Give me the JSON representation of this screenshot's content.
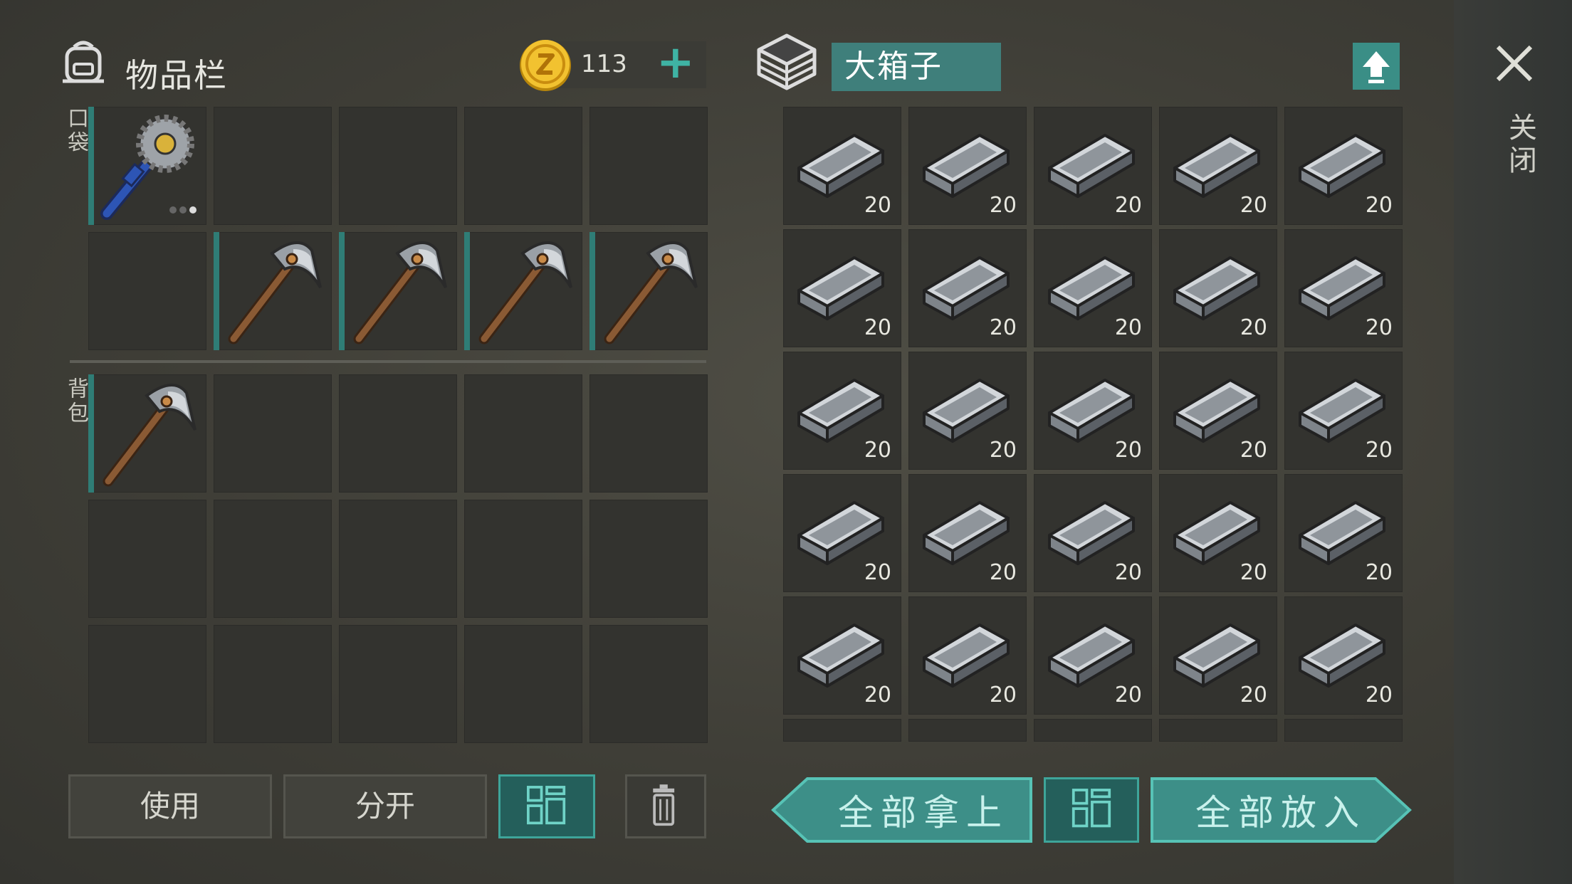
{
  "inventory": {
    "title": "物品栏",
    "coins": "113",
    "plus": "+",
    "pocket_label": "口袋",
    "backpack_label": "背包",
    "pocket_slots": [
      {
        "item": "saw-mace"
      },
      {
        "item": ""
      },
      {
        "item": ""
      },
      {
        "item": ""
      },
      {
        "item": ""
      },
      {
        "item": ""
      },
      {
        "item": "pickaxe"
      },
      {
        "item": "pickaxe"
      },
      {
        "item": "pickaxe"
      },
      {
        "item": "pickaxe"
      }
    ],
    "backpack_slots": [
      {
        "item": "pickaxe"
      },
      {
        "item": ""
      },
      {
        "item": ""
      },
      {
        "item": ""
      },
      {
        "item": ""
      },
      {
        "item": ""
      },
      {
        "item": ""
      },
      {
        "item": ""
      },
      {
        "item": ""
      },
      {
        "item": ""
      },
      {
        "item": ""
      },
      {
        "item": ""
      },
      {
        "item": ""
      },
      {
        "item": ""
      },
      {
        "item": ""
      }
    ]
  },
  "container": {
    "title": "大箱子",
    "close_label": "关闭",
    "slots": [
      {
        "item": "iron-ingot",
        "qty": "20"
      },
      {
        "item": "iron-ingot",
        "qty": "20"
      },
      {
        "item": "iron-ingot",
        "qty": "20"
      },
      {
        "item": "iron-ingot",
        "qty": "20"
      },
      {
        "item": "iron-ingot",
        "qty": "20"
      },
      {
        "item": "iron-ingot",
        "qty": "20"
      },
      {
        "item": "iron-ingot",
        "qty": "20"
      },
      {
        "item": "iron-ingot",
        "qty": "20"
      },
      {
        "item": "iron-ingot",
        "qty": "20"
      },
      {
        "item": "iron-ingot",
        "qty": "20"
      },
      {
        "item": "iron-ingot",
        "qty": "20"
      },
      {
        "item": "iron-ingot",
        "qty": "20"
      },
      {
        "item": "iron-ingot",
        "qty": "20"
      },
      {
        "item": "iron-ingot",
        "qty": "20"
      },
      {
        "item": "iron-ingot",
        "qty": "20"
      },
      {
        "item": "iron-ingot",
        "qty": "20"
      },
      {
        "item": "iron-ingot",
        "qty": "20"
      },
      {
        "item": "iron-ingot",
        "qty": "20"
      },
      {
        "item": "iron-ingot",
        "qty": "20"
      },
      {
        "item": "iron-ingot",
        "qty": "20"
      },
      {
        "item": "iron-ingot",
        "qty": "20"
      },
      {
        "item": "iron-ingot",
        "qty": "20"
      },
      {
        "item": "iron-ingot",
        "qty": "20"
      },
      {
        "item": "iron-ingot",
        "qty": "20"
      },
      {
        "item": "iron-ingot",
        "qty": "20"
      }
    ]
  },
  "actions": {
    "use": "使用",
    "split": "分开",
    "take_all": "全部拿上",
    "put_all": "全部放入"
  },
  "colors": {
    "accent": "#3ea59a",
    "accent_dark": "#245f5b",
    "slot_bg": "#33332f"
  },
  "icons": [
    "backpack-icon",
    "coin-icon",
    "crate-icon",
    "upload-icon",
    "close-icon",
    "sort-grid-icon",
    "trash-icon"
  ]
}
